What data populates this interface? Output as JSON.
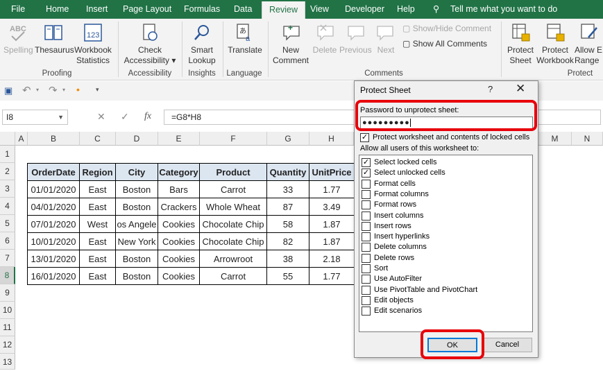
{
  "menu": {
    "tabs": [
      "File",
      "Home",
      "Insert",
      "Page Layout",
      "Formulas",
      "Data",
      "Review",
      "View",
      "Developer",
      "Help"
    ],
    "active": "Review",
    "tellme": "Tell me what you want to do"
  },
  "ribbon": {
    "spelling": "Spelling",
    "thesaurus": "Thesaurus",
    "workbook_stats": [
      "Workbook",
      "Statistics"
    ],
    "check_access": [
      "Check",
      "Accessibility ▾"
    ],
    "smart_lookup": [
      "Smart",
      "Lookup"
    ],
    "translate": "Translate",
    "new_comment": [
      "New",
      "Comment"
    ],
    "delete": "Delete",
    "previous": "Previous",
    "next": "Next",
    "show_hide": "Show/Hide Comment",
    "show_all": "Show All Comments",
    "protect_sheet": [
      "Protect",
      "Sheet"
    ],
    "protect_workbook": [
      "Protect",
      "Workbook"
    ],
    "allow_edit": [
      "Allow E",
      "Range"
    ],
    "groups": [
      "Proofing",
      "Accessibility",
      "Insights",
      "Language",
      "Comments",
      "Protect"
    ]
  },
  "formula": {
    "namebox": "I8",
    "cancel": "✕",
    "enter": "✓",
    "fx": "fx",
    "value": "=G8*H8"
  },
  "sheet": {
    "columns": [
      "A",
      "B",
      "C",
      "D",
      "E",
      "F",
      "G",
      "H",
      "M",
      "N"
    ],
    "rows": [
      "1",
      "2",
      "3",
      "4",
      "5",
      "6",
      "7",
      "8",
      "9",
      "10",
      "11",
      "12",
      "13"
    ],
    "headers": [
      "OrderDate",
      "Region",
      "City",
      "Category",
      "Product",
      "Quantity",
      "UnitPrice"
    ],
    "data": [
      [
        "01/01/2020",
        "East",
        "Boston",
        "Bars",
        "Carrot",
        "33",
        "1.77"
      ],
      [
        "04/01/2020",
        "East",
        "Boston",
        "Crackers",
        "Whole Wheat",
        "87",
        "3.49"
      ],
      [
        "07/01/2020",
        "West",
        "os Angele",
        "Cookies",
        "Chocolate Chip",
        "58",
        "1.87"
      ],
      [
        "10/01/2020",
        "East",
        "New York",
        "Cookies",
        "Chocolate Chip",
        "82",
        "1.87"
      ],
      [
        "13/01/2020",
        "East",
        "Boston",
        "Cookies",
        "Arrowroot",
        "38",
        "2.18"
      ],
      [
        "16/01/2020",
        "East",
        "Boston",
        "Cookies",
        "Carrot",
        "55",
        "1.77"
      ]
    ]
  },
  "dialog": {
    "title": "Protect Sheet",
    "help": "?",
    "close": "✕",
    "password_label": "Password to unprotect sheet:",
    "password_value": "●●●●●●●●●",
    "protect_label": "Protect worksheet and contents of locked cells",
    "allow_label": "Allow all users of this worksheet to:",
    "options": [
      {
        "label": "Select locked cells",
        "checked": true
      },
      {
        "label": "Select unlocked cells",
        "checked": true
      },
      {
        "label": "Format cells",
        "checked": false
      },
      {
        "label": "Format columns",
        "checked": false
      },
      {
        "label": "Format rows",
        "checked": false
      },
      {
        "label": "Insert columns",
        "checked": false
      },
      {
        "label": "Insert rows",
        "checked": false
      },
      {
        "label": "Insert hyperlinks",
        "checked": false
      },
      {
        "label": "Delete columns",
        "checked": false
      },
      {
        "label": "Delete rows",
        "checked": false
      },
      {
        "label": "Sort",
        "checked": false
      },
      {
        "label": "Use AutoFilter",
        "checked": false
      },
      {
        "label": "Use PivotTable and PivotChart",
        "checked": false
      },
      {
        "label": "Edit objects",
        "checked": false
      },
      {
        "label": "Edit scenarios",
        "checked": false
      }
    ],
    "ok": "OK",
    "cancel": "Cancel"
  },
  "colors": {
    "excel_green": "#217346",
    "highlight": "#e8000b",
    "header_fill": "#dce6f1"
  }
}
